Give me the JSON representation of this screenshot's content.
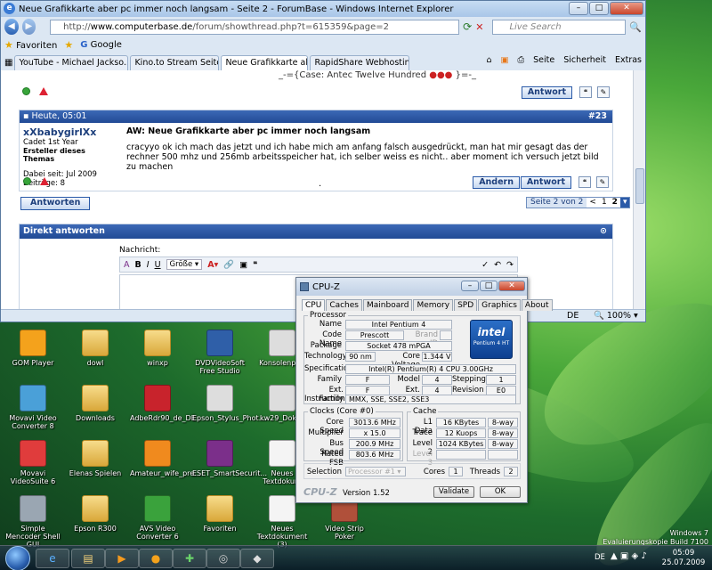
{
  "ie": {
    "title": "Neue Grafikkarte aber pc immer noch langsam - Seite 2 - ForumBase - Windows Internet Explorer",
    "url_prefix": "http://",
    "url_host": "www.computerbase.de",
    "url_path": "/forum/showthread.php?t=615359&page=2",
    "search_placeholder": "Live Search",
    "favorites_label": "Favoriten",
    "google_label": "Google",
    "tabs": [
      "YouTube - Michael Jackso...",
      "Kino.to Stream Seite - Seri...",
      "Neue Grafikkarte aber ...",
      "RapidShare Webhosting +..."
    ],
    "tools": [
      "Seite",
      "Sicherheit",
      "Extras"
    ],
    "status_lang": "DE",
    "zoom": "100%"
  },
  "forum": {
    "sig_text": "_-={Case: Antec Twelve Hundred",
    "sig_end": "}=-_",
    "reply_btn": "Antwort",
    "edit_btn": "Ändern",
    "post_date": "Heute, 05:01",
    "post_num": "#23",
    "user_name": "xXbabygirlXx",
    "user_rank": "Cadet 1st Year",
    "user_role": "Ersteller dieses Themas",
    "user_joined": "Dabei seit: Jul 2009",
    "user_posts": "Beiträge: 8",
    "post_title": "AW: Neue Grafikkarte aber pc immer noch langsam",
    "post_body": "cracyyo ok ich mach das jetzt und ich habe mich am anfang falsch ausgedrückt, man hat mir gesagt das der rechner 500 mhz und 256mb arbeitsspeicher hat, ich selber weiss es nicht.. aber moment ich versuch jetzt bild zu machen",
    "antworten_btn": "Antworten",
    "page_label": "Seite 2 von 2",
    "page_prev": "<",
    "page_1": "1",
    "page_2": "2",
    "quick_reply_title": "Direkt antworten",
    "message_label": "Nachricht:",
    "size_select": "Größe",
    "bold": "B",
    "italic": "I",
    "underline": "U"
  },
  "cpuz": {
    "title": "CPU-Z",
    "tabs": [
      "CPU",
      "Caches",
      "Mainboard",
      "Memory",
      "SPD",
      "Graphics",
      "About"
    ],
    "processor_legend": "Processor",
    "name_label": "Name",
    "name": "Intel Pentium 4",
    "codename_label": "Code Name",
    "codename": "Prescott",
    "brandid_label": "Brand ID",
    "package_label": "Package",
    "package": "Socket 478 mPGA",
    "technology_label": "Technology",
    "technology": "90 nm",
    "corevoltage_label": "Core Voltage",
    "corevoltage": "1.344 V",
    "spec_label": "Specification",
    "spec": "Intel(R) Pentium(R) 4 CPU 3.00GHz",
    "family_label": "Family",
    "family": "F",
    "model_label": "Model",
    "model": "4",
    "stepping_label": "Stepping",
    "stepping": "1",
    "extfamily_label": "Ext. Family",
    "extfamily": "F",
    "extmodel_label": "Ext. Model",
    "extmodel": "4",
    "revision_label": "Revision",
    "revision": "E0",
    "instructions_label": "Instructions",
    "instructions": "MMX, SSE, SSE2, SSE3",
    "clocks_legend": "Clocks (Core #0)",
    "corespeed_label": "Core Speed",
    "corespeed": "3013.6 MHz",
    "multiplier_label": "Multiplier",
    "multiplier": "x 15.0",
    "busspeed_label": "Bus Speed",
    "busspeed": "200.9 MHz",
    "ratedfsb_label": "Rated FSB",
    "ratedfsb": "803.6 MHz",
    "cache_legend": "Cache",
    "l1_label": "L1 Data",
    "l1": "16 KBytes",
    "l1_way": "8-way",
    "trace_label": "Trace",
    "trace": "12 Kuops",
    "trace_way": "8-way",
    "l2_label": "Level 2",
    "l2": "1024 KBytes",
    "l2_way": "8-way",
    "l3_label": "Level 3",
    "selection_label": "Selection",
    "selection": "Processor #1",
    "cores_label": "Cores",
    "cores": "1",
    "threads_label": "Threads",
    "threads": "2",
    "brand": "CPU-Z",
    "version": "Version 1.52",
    "validate": "Validate",
    "ok": "OK",
    "intel_logo": "intel",
    "intel_sub": "Pentium 4 HT"
  },
  "desktop_icons": [
    {
      "label": "GOM Player",
      "color": "#f4a21c"
    },
    {
      "label": "dowl",
      "color": "folder"
    },
    {
      "label": "winxp",
      "color": "folder"
    },
    {
      "label": "DVDVideoSoft Free Studio",
      "color": "#2f5fa8"
    },
    {
      "label": "Konsolenprin",
      "color": "#dddddd"
    },
    {
      "label": "Movavi Video Converter 8",
      "color": "#4aa0d8"
    },
    {
      "label": "Downloads",
      "color": "folder"
    },
    {
      "label": "AdbeRdr90_de_DE",
      "color": "#c8232c"
    },
    {
      "label": "Epson_Stylus_Phot...",
      "color": "#dddddd"
    },
    {
      "label": "kw29_Dok-D",
      "color": "#dddddd"
    },
    {
      "label": "Movavi VideoSuite 6",
      "color": "#e03c3c"
    },
    {
      "label": "Elenas Spielen",
      "color": "folder"
    },
    {
      "label": "Amateur_wife_pre...",
      "color": "#f08a1e"
    },
    {
      "label": "ESET_SmartSecurit...",
      "color": "#7b2f8a"
    },
    {
      "label": "Neues Textdokum",
      "color": "#f4f4f4"
    },
    {
      "label": "Simple Mencoder Shell GUI",
      "color": "#9aa6b2"
    },
    {
      "label": "Epson R300",
      "color": "folder"
    },
    {
      "label": "AVS Video Converter 6",
      "color": "#3aa23c"
    },
    {
      "label": "Favoriten",
      "color": "folder"
    },
    {
      "label": "Neues Textdokument (3)",
      "color": "#f4f4f4"
    },
    {
      "label": "Video Strip Poker",
      "color": "#b0503a"
    }
  ],
  "system": {
    "watermark_line1": "Windows 7",
    "watermark_line2": "Evaluierungskopie Build 7100",
    "lang": "DE",
    "time": "05:09",
    "date": "25.07.2009"
  }
}
